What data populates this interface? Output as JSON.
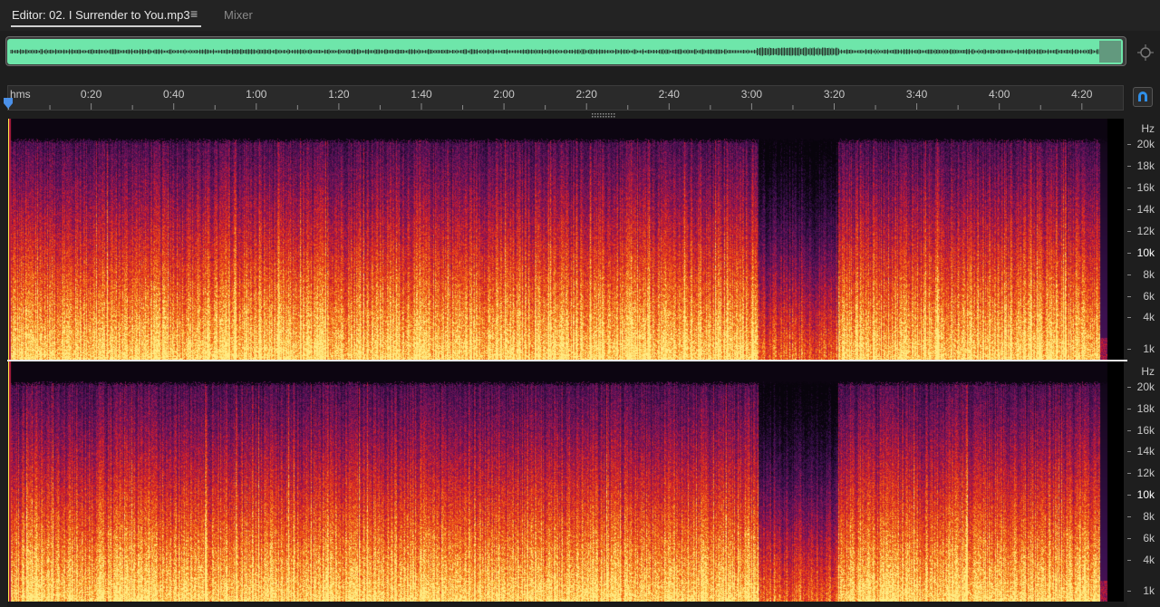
{
  "tabs": {
    "editor_label": "Editor: 02. I Surrender to You.mp3",
    "menu_icon": "≡",
    "mixer_label": "Mixer"
  },
  "timeline": {
    "unit_label": "hms",
    "duration_seconds": 266,
    "labels": [
      {
        "seconds": 20,
        "text": "0:20"
      },
      {
        "seconds": 40,
        "text": "0:40"
      },
      {
        "seconds": 60,
        "text": "1:00"
      },
      {
        "seconds": 80,
        "text": "1:20"
      },
      {
        "seconds": 100,
        "text": "1:40"
      },
      {
        "seconds": 120,
        "text": "2:00"
      },
      {
        "seconds": 140,
        "text": "2:20"
      },
      {
        "seconds": 160,
        "text": "2:40"
      },
      {
        "seconds": 180,
        "text": "3:00"
      },
      {
        "seconds": 200,
        "text": "3:20"
      },
      {
        "seconds": 220,
        "text": "3:40"
      },
      {
        "seconds": 240,
        "text": "4:00"
      },
      {
        "seconds": 260,
        "text": "4:20"
      }
    ],
    "playhead_seconds": 0
  },
  "frequency_axis": {
    "unit_label": "Hz",
    "labels": [
      "20k",
      "18k",
      "16k",
      "14k",
      "12k",
      "10k",
      "8k",
      "6k",
      "4k",
      "1k"
    ],
    "highlight": [
      "10k"
    ]
  },
  "icons": {
    "zoom": "zoom-magnifier-icon",
    "snap": "snap-magnet-icon",
    "menu": "hamburger-menu-icon",
    "playhead": "playhead-marker-icon"
  },
  "colors": {
    "waveform_overview": "#6ee6aa",
    "spectrogram_low": "#ffe070",
    "spectrogram_mid": "#ee3a1c",
    "spectrogram_high": "#5a1a6c",
    "playhead": "#4a90e8",
    "snap_icon": "#2f8fe8"
  }
}
